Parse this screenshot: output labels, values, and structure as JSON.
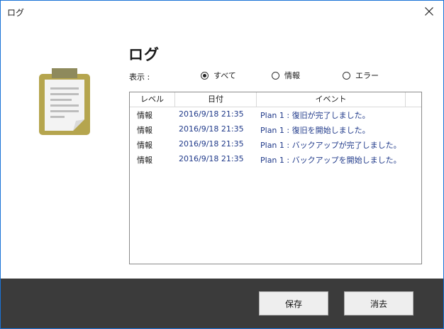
{
  "window": {
    "title": "ログ"
  },
  "heading": "ログ",
  "filter": {
    "label": "表示 :",
    "options": [
      {
        "label": "すべて",
        "selected": true
      },
      {
        "label": "情報",
        "selected": false
      },
      {
        "label": "エラー",
        "selected": false
      }
    ]
  },
  "table": {
    "columns": [
      "レベル",
      "日付",
      "イベント"
    ],
    "rows": [
      {
        "level": "情報",
        "date": "2016/9/18 21:35",
        "event": "Plan 1 : 復旧が完了しました。"
      },
      {
        "level": "情報",
        "date": "2016/9/18 21:35",
        "event": "Plan 1 : 復旧を開始しました。"
      },
      {
        "level": "情報",
        "date": "2016/9/18 21:35",
        "event": "Plan 1 : バックアップが完了しました。"
      },
      {
        "level": "情報",
        "date": "2016/9/18 21:35",
        "event": "Plan 1 : バックアップを開始しました。"
      }
    ]
  },
  "buttons": {
    "save": "保存",
    "clear": "消去"
  },
  "colors": {
    "accent_border": "#1a73d6",
    "footer": "#3b3b3b",
    "clipboard_gold": "#b5a54e",
    "link_text": "#203a8a"
  }
}
